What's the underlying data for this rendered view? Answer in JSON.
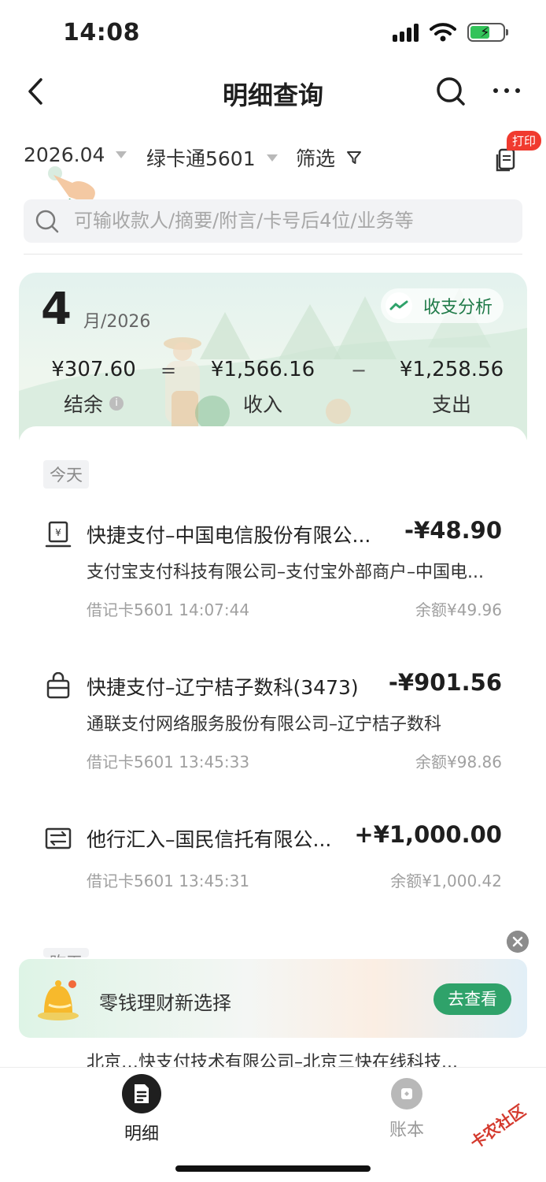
{
  "status_bar": {
    "time": "14:08"
  },
  "nav": {
    "title": "明细查询"
  },
  "filters": {
    "date": "2026.04",
    "card": "绿卡通5601",
    "filter_label": "筛选",
    "print_badge": "打印"
  },
  "search": {
    "placeholder": "可输收款人/摘要/附言/卡号后4位/业务等"
  },
  "summary": {
    "month": "4",
    "month_suffix": "月/2026",
    "analysis_label": "收支分析",
    "balance_value": "¥307.60",
    "balance_label": "结余",
    "equals": "=",
    "income_value": "¥1,566.16",
    "income_label": "收入",
    "minus": "−",
    "expense_value": "¥1,258.56",
    "expense_label": "支出"
  },
  "list": {
    "today_label": "今天",
    "yesterday_label": "昨天",
    "transactions": [
      {
        "icon": "receipt-icon",
        "title": "快捷支付–中国电信股份有限公...",
        "amount": "-¥48.90",
        "desc": "支付宝支付科技有限公司–支付宝外部商户–中国电...",
        "meta": "借记卡5601 14:07:44",
        "balance": "余额¥49.96"
      },
      {
        "icon": "shopping-bag-icon",
        "title": "快捷支付–辽宁桔子数科(3473)",
        "amount": "-¥901.56",
        "desc": "通联支付网络服务股份有限公司–辽宁桔子数科",
        "meta": "借记卡5601 13:45:33",
        "balance": "余额¥98.86"
      },
      {
        "icon": "transfer-icon",
        "title": "他行汇入–国民信托有限公...",
        "amount": "+¥1,000.00",
        "desc": "",
        "meta": "借记卡5601 13:45:31",
        "balance": "余额¥1,000.42"
      }
    ],
    "peek_text": "北京…快支付技术有限公司–北京三快在线科技..."
  },
  "promo": {
    "text": "零钱理财新选择",
    "button": "去查看"
  },
  "tabs": [
    {
      "label": "明细",
      "active": true
    },
    {
      "label": "账本",
      "active": false
    }
  ],
  "watermark": "卡农社区",
  "colors": {
    "accent_green": "#2fa26a",
    "badge_red": "#f03a2f",
    "text_primary": "#1f1f1f",
    "text_muted": "#a0a0a0"
  }
}
